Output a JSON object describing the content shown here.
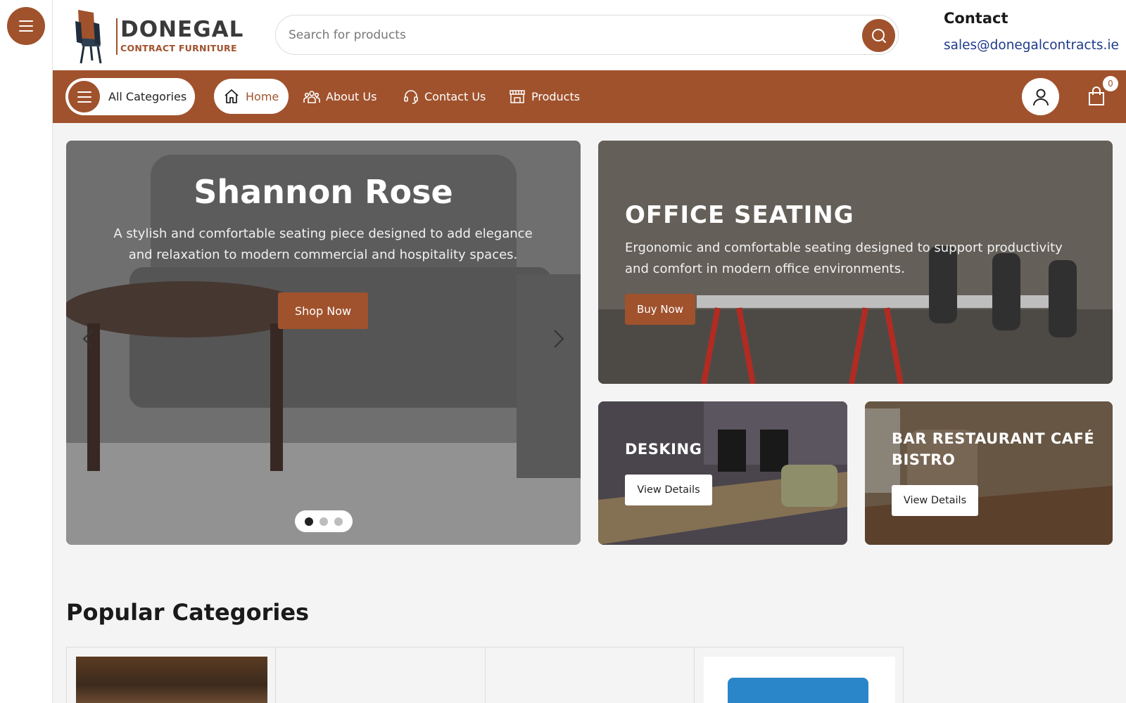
{
  "brand": {
    "name": "DONEGAL",
    "tagline": "CONTRACT FURNITURE",
    "accent_color": "#a0522d",
    "link_color": "#1e3a8a"
  },
  "search": {
    "placeholder": "Search for products",
    "value": ""
  },
  "contact": {
    "title": "Contact",
    "email": "sales@donegalcontracts.ie"
  },
  "nav": {
    "all_categories": "All Categories",
    "items": [
      {
        "label": "Home",
        "icon": "home-icon",
        "active": true
      },
      {
        "label": "About Us",
        "icon": "users-icon",
        "active": false
      },
      {
        "label": "Contact Us",
        "icon": "headset-icon",
        "active": false
      },
      {
        "label": "Products",
        "icon": "store-icon",
        "active": false
      }
    ],
    "cart_count": "0"
  },
  "hero": {
    "title": "Shannon Rose",
    "description": "A stylish and comfortable seating piece designed to add elegance and relaxation to modern commercial and hospitality spaces.",
    "button": "Shop Now",
    "slides": 3,
    "active_slide": 1
  },
  "promos": {
    "office": {
      "title": "OFFICE SEATING",
      "description": "Ergonomic and comfortable seating designed to support productivity and comfort in modern office environments.",
      "button": "Buy Now"
    },
    "desking": {
      "title": "DESKING",
      "button": "View Details"
    },
    "bar": {
      "title": "BAR RESTAURANT CAFÉ BISTRO",
      "button": "View Details"
    }
  },
  "popular": {
    "title": "Popular Categories"
  }
}
